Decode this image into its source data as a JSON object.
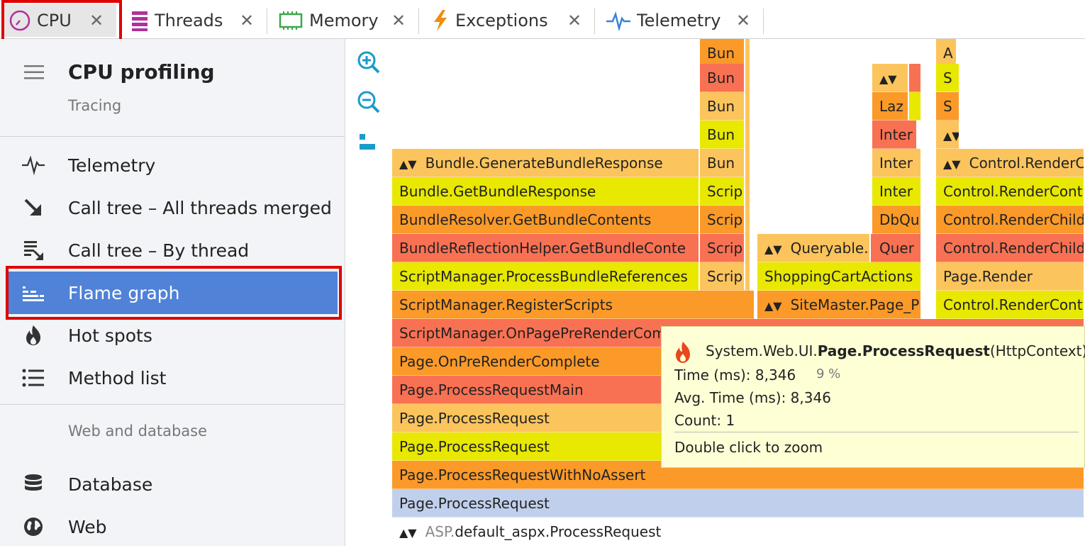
{
  "tabs": [
    {
      "label": "CPU",
      "icon": "clock-icon",
      "active": true
    },
    {
      "label": "Threads",
      "icon": "threads-icon"
    },
    {
      "label": "Memory",
      "icon": "memory-chip-icon"
    },
    {
      "label": "Exceptions",
      "icon": "lightning-icon"
    },
    {
      "label": "Telemetry",
      "icon": "pulse-icon"
    }
  ],
  "tab_close_glyph": "✕",
  "sidebar": {
    "title": "CPU profiling",
    "subtitle": "Tracing",
    "items": [
      {
        "label": "Telemetry",
        "icon": "pulse-icon"
      },
      {
        "label": "Call tree – All threads merged",
        "icon": "arrow-down-right-icon"
      },
      {
        "label": "Call tree – By thread",
        "icon": "thread-tree-icon"
      },
      {
        "label": "Flame graph",
        "icon": "flame-graph-icon",
        "selected": true
      },
      {
        "label": "Hot spots",
        "icon": "fire-icon"
      },
      {
        "label": "Method list",
        "icon": "list-icon"
      }
    ],
    "section_label": "Web and database",
    "section_items": [
      {
        "label": "Database",
        "icon": "database-icon"
      },
      {
        "label": "Web",
        "icon": "globe-icon"
      }
    ]
  },
  "tools": [
    "zoom-in-icon",
    "zoom-out-icon",
    "align-icon"
  ],
  "flame": {
    "labels": {
      "bundle_generate": "Bundle.GenerateBundleResponse",
      "bundle_get": "Bundle.GetBundleResponse",
      "bundle_resolver": "BundleResolver.GetBundleContents",
      "bundle_reflection": "BundleReflectionHelper.GetBundleConte",
      "script_process": "ScriptManager.ProcessBundleReferences",
      "script_register": "ScriptManager.RegisterScripts",
      "script_prerender": "ScriptManager.OnPagePreRenderCom",
      "page_prerender_complete": "Page.OnPreRenderComplete",
      "page_process_main": "Page.ProcessRequestMain",
      "page_process_1": "Page.ProcessRequest",
      "page_process_2": "Page.ProcessRequest",
      "page_no_assert": "Page.ProcessRequestWithNoAssert",
      "page_process_sel": "Page.ProcessRequest",
      "root_ns": "ASP.",
      "root_rest": "default_aspx.ProcessRequest",
      "bun": "Bun",
      "scrip": "Scrip",
      "queryable": "Queryable.S",
      "shopping": "ShoppingCartActions",
      "sitemaster": "SiteMaster.Page_P",
      "laz": "Laz",
      "inter": "Inter",
      "dbqu": "DbQu",
      "quer": "Quer",
      "a": "A",
      "s": "S",
      "control_render_co": "Control.RenderCo",
      "control_render_cont": "Control.RenderCont",
      "control_render_child": "Control.RenderChild",
      "page_render": "Page.Render"
    }
  },
  "tooltip": {
    "prefix": "System.Web.UI.",
    "method": "Page.ProcessRequest",
    "suffix": "(HttpContext)",
    "time": "Time (ms): 8,346",
    "percent": "9 %",
    "avg": "Avg. Time (ms): 8,346",
    "count": "Count: 1",
    "hint": "Double click to zoom"
  }
}
